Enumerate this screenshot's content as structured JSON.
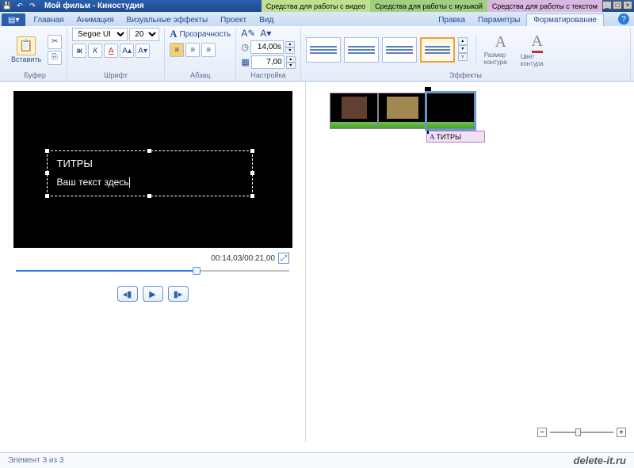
{
  "title": "Мой фильм - Киностудия",
  "context_tabs": {
    "video": "Средства для работы с видео",
    "music": "Средства для работы с музыкой",
    "text": "Средства для работы с текстом"
  },
  "tabs": {
    "file_glyph": "▾",
    "items": [
      "Главная",
      "Анимация",
      "Визуальные эффекты",
      "Проект",
      "Вид"
    ],
    "edit": "Правка",
    "params": "Параметры",
    "format": "Форматирование"
  },
  "ribbon": {
    "buffer": {
      "paste": "Вставить",
      "label": "Буфер"
    },
    "font": {
      "family": "Segoe UI",
      "size": "20",
      "label": "Шрифт",
      "bold": "ж",
      "italic": "К",
      "color": "A",
      "grow": "A▴",
      "shrink": "A▾"
    },
    "para": {
      "transparency": "Прозрачность",
      "label": "Абзац"
    },
    "setup": {
      "edit_icon": "A✎",
      "bg_icon": "A▾",
      "duration": "14,00s",
      "start": "7,00",
      "label": "Настройка"
    },
    "fx": {
      "label": "Эффекты",
      "outline_size": "Размер контура",
      "outline_color": "Цвет контура"
    }
  },
  "preview": {
    "title_text": "ТИТРЫ",
    "placeholder": "Ваш текст здесь",
    "timecode": "00:14,03/00:21,00"
  },
  "timeline": {
    "caption": "ТИТРЫ"
  },
  "status": {
    "left": "Элемент 3 из 3",
    "brand": "delete-it.ru"
  }
}
